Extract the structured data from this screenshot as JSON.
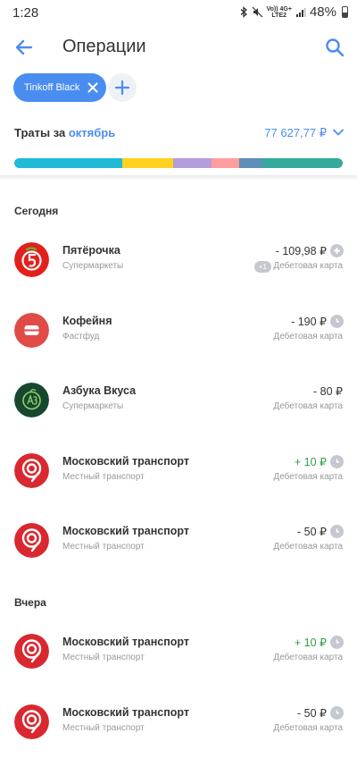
{
  "status_bar": {
    "time": "1:28",
    "network_line1": "Vo)) 4G+",
    "network_line2": "LTE2",
    "battery": "48%"
  },
  "header": {
    "title": "Операции"
  },
  "filter": {
    "chip_label": "Tinkoff Black"
  },
  "spending": {
    "label": "Траты за",
    "month": "октябрь",
    "total": "77 627,77 ₽",
    "breakdown_colors": [
      "#1fbad6",
      "#ffd21f",
      "#b39ddb",
      "#ff9e9e",
      "#5d8fb8",
      "#35a99b"
    ],
    "breakdown_shares": [
      0.33,
      0.155,
      0.115,
      0.085,
      0.07,
      0.245
    ]
  },
  "sections": [
    {
      "title": "Сегодня",
      "items": [
        {
          "name": "Пятёрочка",
          "category": "Супермаркеты",
          "amount": "- 109,98 ₽",
          "positive": false,
          "status": "plus-icon",
          "card": "Дебетовая карта",
          "badge": "+1",
          "logo": "pyaterochka"
        },
        {
          "name": "Кофейня",
          "category": "Фастфуд",
          "amount": "- 190 ₽",
          "positive": false,
          "status": "clock-icon",
          "card": "Дебетовая карта",
          "logo": "coffee"
        },
        {
          "name": "Азбука Вкуса",
          "category": "Супермаркеты",
          "amount": "- 80 ₽",
          "positive": false,
          "status": "none",
          "card": "Дебетовая карта",
          "logo": "azbuka"
        },
        {
          "name": "Московский транспорт",
          "category": "Местный транспорт",
          "amount": "+ 10 ₽",
          "positive": true,
          "status": "clock-icon",
          "card": "Дебетовая карта",
          "logo": "transport"
        },
        {
          "name": "Московский транспорт",
          "category": "Местный транспорт",
          "amount": "- 50 ₽",
          "positive": false,
          "status": "clock-icon",
          "card": "Дебетовая карта",
          "logo": "transport"
        }
      ]
    },
    {
      "title": "Вчера",
      "items": [
        {
          "name": "Московский транспорт",
          "category": "Местный транспорт",
          "amount": "+ 10 ₽",
          "positive": true,
          "status": "clock-icon",
          "card": "Дебетовая карта",
          "logo": "transport"
        },
        {
          "name": "Московский транспорт",
          "category": "Местный транспорт",
          "amount": "- 50 ₽",
          "positive": false,
          "status": "clock-icon",
          "card": "Дебетовая карта",
          "logo": "transport"
        }
      ]
    }
  ]
}
